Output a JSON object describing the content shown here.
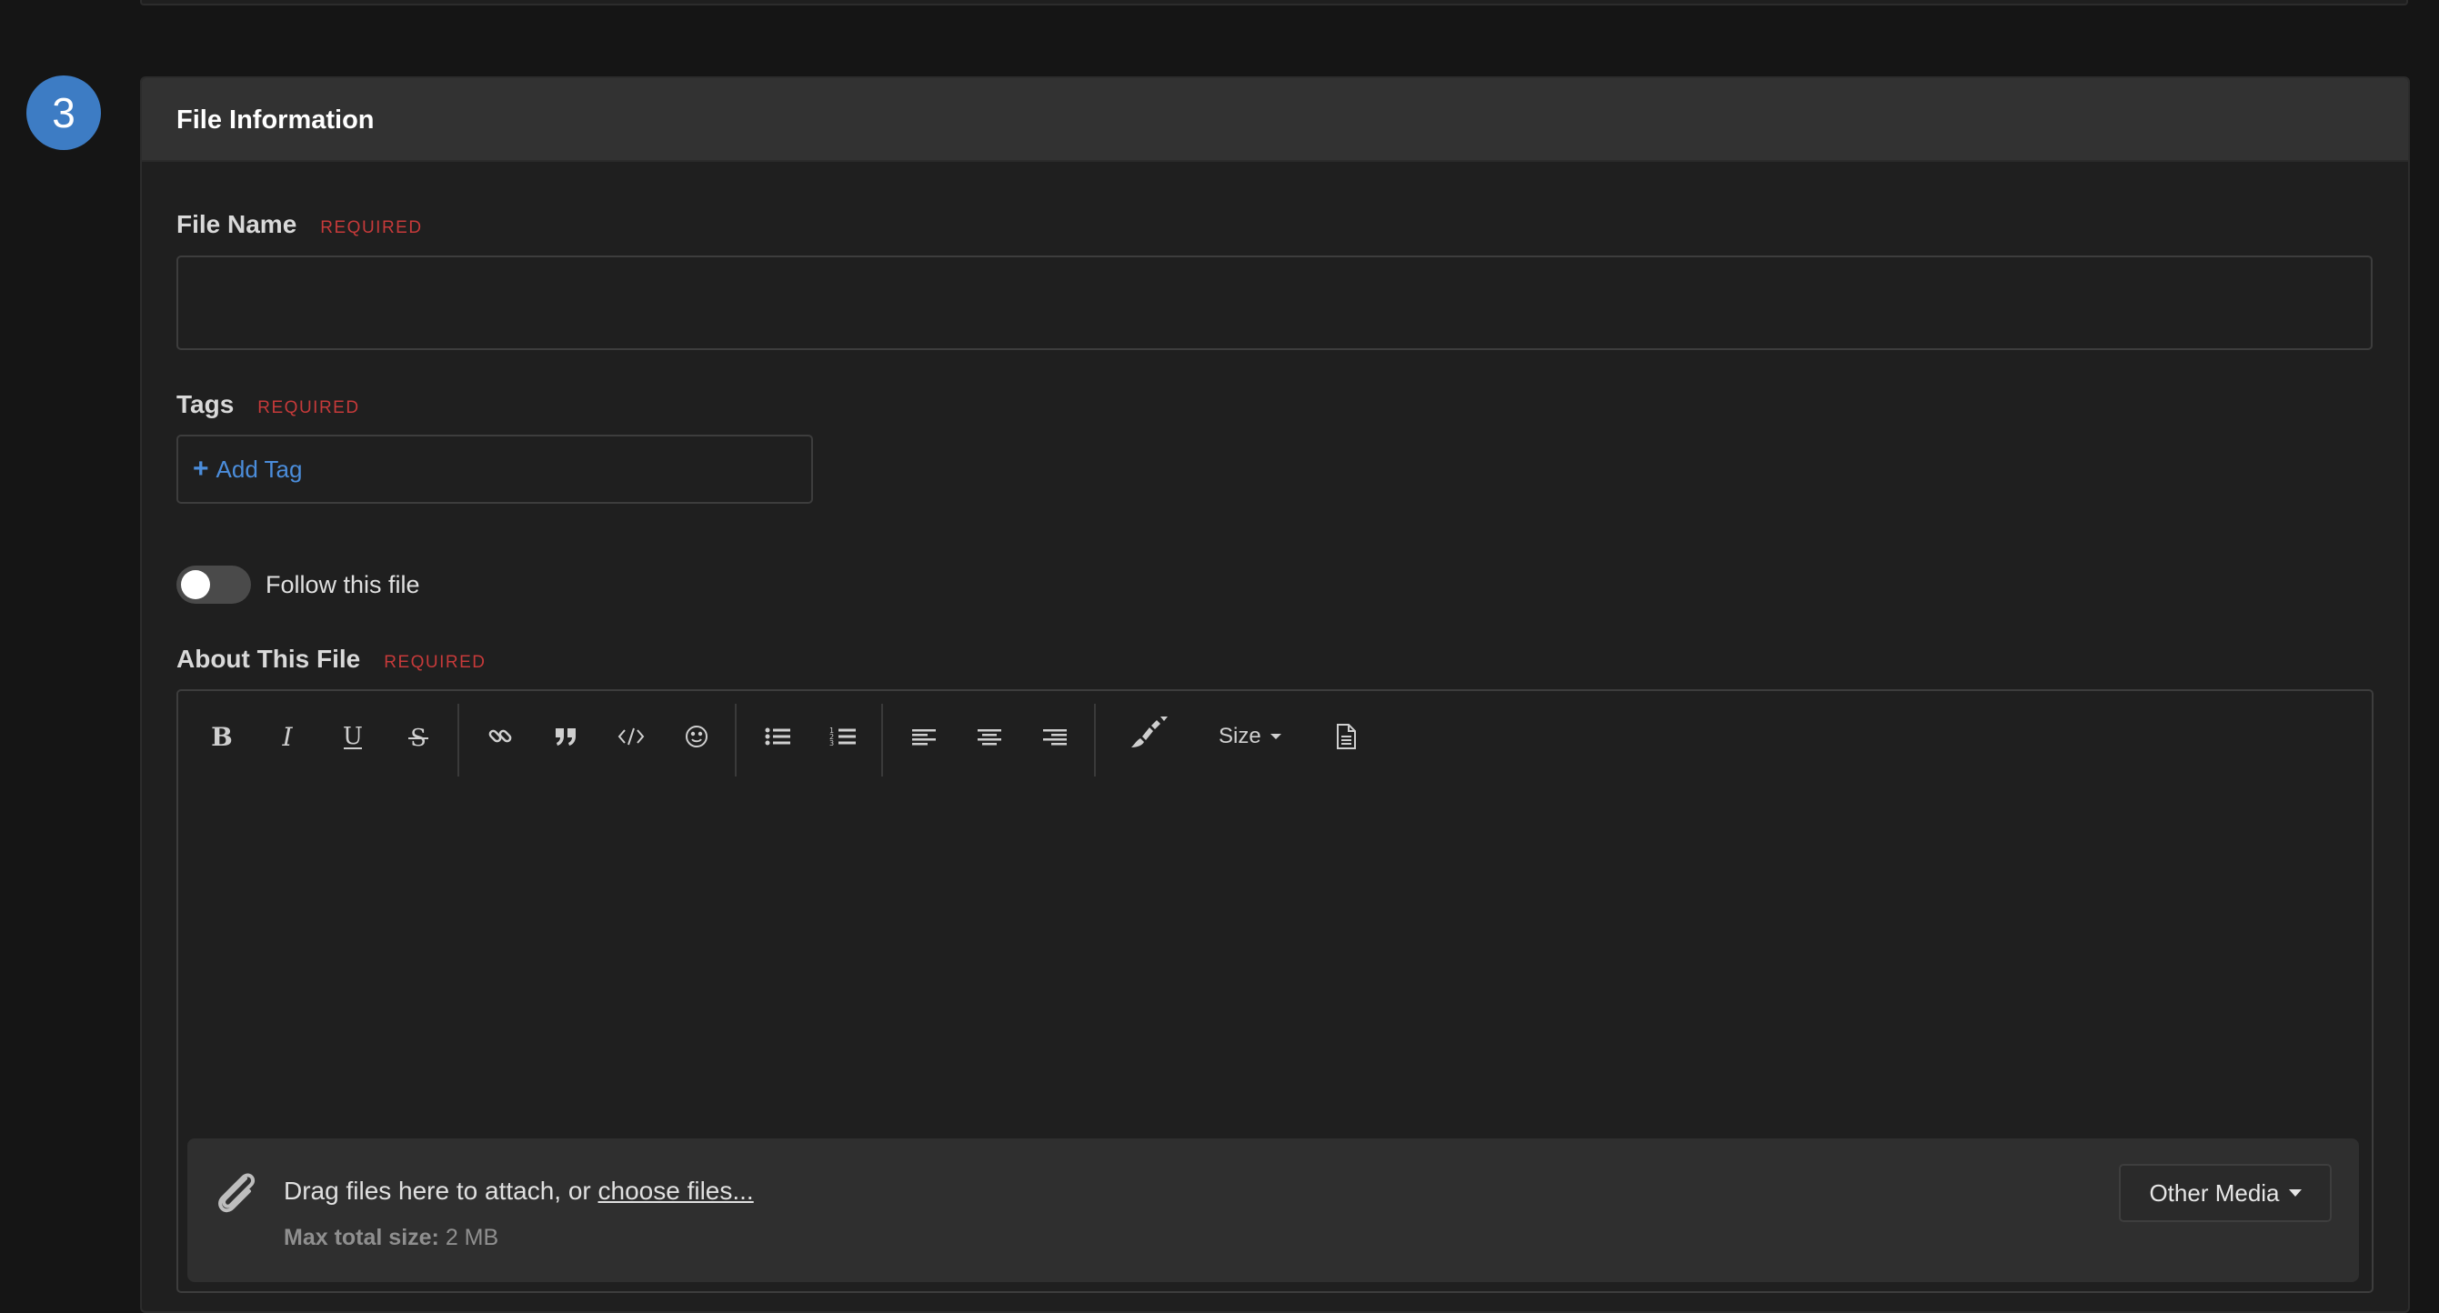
{
  "step": {
    "number": "3"
  },
  "panel": {
    "title": "File Information"
  },
  "fields": {
    "file_name": {
      "label": "File Name",
      "required": "REQUIRED",
      "value": ""
    },
    "tags": {
      "label": "Tags",
      "required": "REQUIRED",
      "add_tag_label": "Add Tag",
      "add_tag_icon": "+"
    },
    "follow": {
      "label": "Follow this file",
      "enabled": false
    },
    "about": {
      "label": "About This File",
      "required": "REQUIRED"
    }
  },
  "editor": {
    "toolbar": {
      "buttons": [
        "bold",
        "italic",
        "underline",
        "strikethrough",
        "link",
        "quote",
        "code",
        "emoji",
        "bullet-list",
        "numbered-list",
        "align-left",
        "align-center",
        "align-right",
        "text-color",
        "size",
        "template"
      ],
      "size_label": "Size"
    },
    "attachments": {
      "drop_text": "Drag files here to attach, or ",
      "choose_files": "choose files...",
      "max_label": "Max total size:",
      "max_value": "2 MB",
      "other_media": "Other Media"
    }
  },
  "colors": {
    "accent": "#3d7cc4",
    "link": "#4b8ddb",
    "required": "#c63a3a"
  }
}
